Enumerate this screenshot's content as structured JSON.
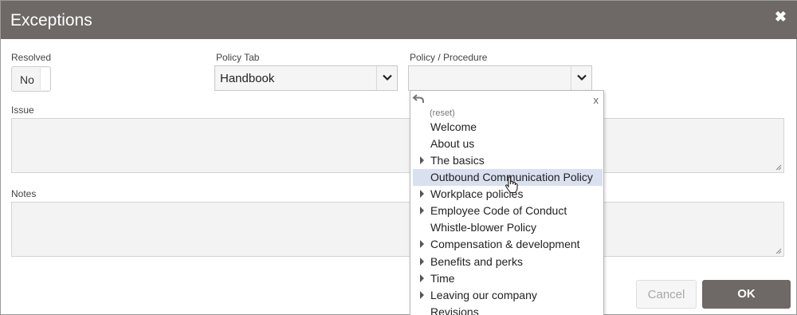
{
  "dialog": {
    "title": "Exceptions",
    "close_glyph": "✖"
  },
  "resolved": {
    "label": "Resolved",
    "value": "No"
  },
  "policy_tab": {
    "label": "Policy Tab",
    "value": "Handbook"
  },
  "policy_procedure": {
    "label": "Policy / Procedure",
    "value": ""
  },
  "issue": {
    "label": "Issue",
    "value": ""
  },
  "notes": {
    "label": "Notes",
    "value": ""
  },
  "dropdown": {
    "close_glyph": "x",
    "reset_label": "(reset)",
    "items": [
      {
        "label": "Welcome",
        "expandable": false
      },
      {
        "label": "About us",
        "expandable": false
      },
      {
        "label": "The basics",
        "expandable": true
      },
      {
        "label": "Outbound Communication Policy",
        "expandable": false
      },
      {
        "label": "Workplace policies",
        "expandable": true
      },
      {
        "label": "Employee Code of Conduct",
        "expandable": true
      },
      {
        "label": "Whistle-blower Policy",
        "expandable": false
      },
      {
        "label": "Compensation & development",
        "expandable": true
      },
      {
        "label": "Benefits and perks",
        "expandable": true
      },
      {
        "label": "Time",
        "expandable": true
      },
      {
        "label": "Leaving our company",
        "expandable": true
      },
      {
        "label": "Revisions",
        "expandable": false
      }
    ]
  },
  "buttons": {
    "cancel_label": "Cancel",
    "ok_label": "OK"
  },
  "colors": {
    "titlebar": "#6e6966",
    "hover_row": "#d9e0ef"
  }
}
